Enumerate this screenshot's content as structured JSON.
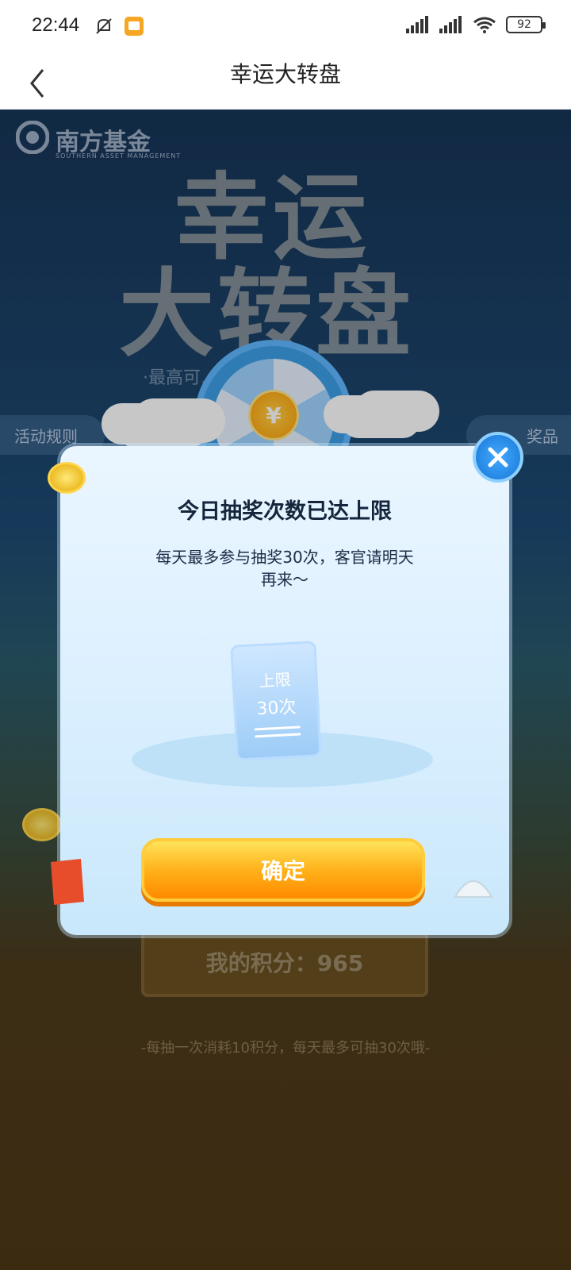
{
  "status_bar": {
    "time": "22:44",
    "icons": [
      "mute-icon",
      "notification-app-icon",
      "signal-icon",
      "hd-signal-icon",
      "wifi-icon",
      "battery-icon"
    ],
    "battery": "92"
  },
  "nav": {
    "title": "幸运大转盘"
  },
  "background": {
    "brand_name": "南方基金",
    "brand_sub": "SOUTHERN ASSET MANAGEMENT",
    "hero_line1": "幸运",
    "hero_line2": "大转盘",
    "hero_sub": "·最高可…东电子卡·",
    "tab_left": "活动规则",
    "tab_right": "奖品",
    "wheel_symbol": "¥",
    "score_label": "我的积分：965",
    "footer_note": "-每抽一次消耗10积分，每天最多可抽30次哦-"
  },
  "modal": {
    "title": "今日抽奖次数已达上限",
    "message": "每天最多参与抽奖30次，客官请明天再来～",
    "ticket_line1": "上限",
    "ticket_line2": "30次",
    "confirm_label": "确定"
  }
}
